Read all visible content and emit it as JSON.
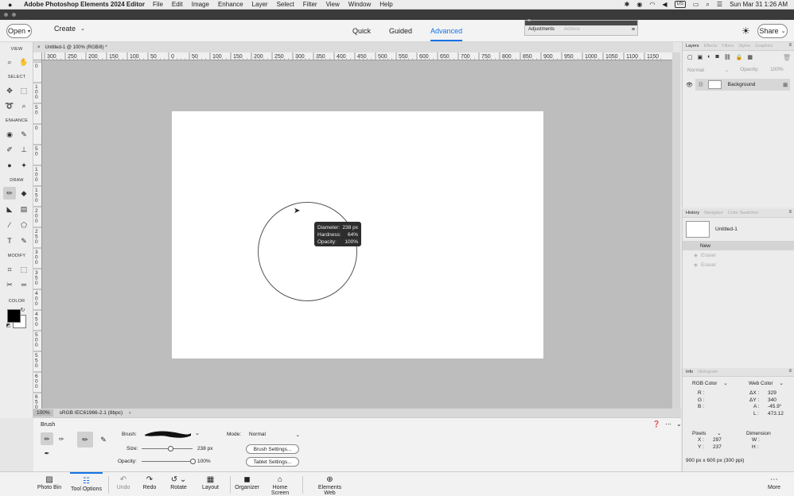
{
  "menubar": {
    "app_name": "Adobe Photoshop Elements 2024 Editor",
    "items": [
      "File",
      "Edit",
      "Image",
      "Enhance",
      "Layer",
      "Select",
      "Filter",
      "View",
      "Window",
      "Help"
    ],
    "keyboard": "US",
    "datetime": "Sun Mar 31  1:26 AM"
  },
  "topbar": {
    "open_label": "Open",
    "create_label": "Create",
    "modes": [
      "Quick",
      "Guided",
      "Advanced"
    ],
    "active_mode": "Advanced",
    "share_label": "Share"
  },
  "floating_panel": {
    "tabs": [
      "Adjustments",
      "Actions"
    ]
  },
  "document": {
    "tab_title": "Untitled-1 @ 100% (RGB/8) *",
    "zoom": "100%",
    "profile": "sRGB IEC61966-2.1 (8bpc)"
  },
  "rulers": {
    "h_labels": [
      "300",
      "250",
      "200",
      "150",
      "100",
      "50",
      "0",
      "50",
      "100",
      "150",
      "200",
      "250",
      "300",
      "350",
      "400",
      "450",
      "500",
      "550",
      "600",
      "650",
      "700",
      "750",
      "800",
      "850",
      "900",
      "950",
      "1000",
      "1050",
      "1100",
      "1150"
    ],
    "v_labels": [
      "0",
      "1\n0\n0",
      "5\n0",
      "0",
      "5\n0",
      "1\n0\n0",
      "1\n5\n0",
      "2\n0\n0",
      "2\n5\n0",
      "3\n0\n0",
      "3\n5\n0",
      "4\n0\n0",
      "4\n5\n0",
      "5\n0\n0",
      "5\n5\n0",
      "6\n0\n0",
      "6\n5\n0",
      "7"
    ]
  },
  "toolbar": {
    "sections": [
      "VIEW",
      "SELECT",
      "ENHANCE",
      "DRAW",
      "MODIFY",
      "COLOR"
    ]
  },
  "brush_tooltip": {
    "diameter_label": "Diameter:",
    "diameter_value": "238 px",
    "hardness_label": "Hardness:",
    "hardness_value": "64%",
    "opacity_label": "Opacity:",
    "opacity_value": "100%"
  },
  "layers_panel": {
    "tabs": [
      "Layers",
      "Effects",
      "Filters",
      "Styles",
      "Graphics"
    ],
    "blend_mode": "Normal",
    "opacity_label": "Opacity:",
    "opacity_value": "100%",
    "layer_name": "Background"
  },
  "history_panel": {
    "tabs": [
      "History",
      "Navigator",
      "Color Swatches"
    ],
    "snapshot": "Untitled-1",
    "states": [
      {
        "label": "New",
        "active": true
      },
      {
        "label": "Eraser",
        "active": false
      },
      {
        "label": "Eraser",
        "active": false
      }
    ]
  },
  "info_panel": {
    "tabs": [
      "Info",
      "Histogram"
    ],
    "left_mode": "RGB Color",
    "right_mode": "Web Color",
    "r_label": "R :",
    "g_label": "G :",
    "b_label": "B :",
    "dx_label": "ΔX :",
    "dx_value": "329",
    "dy_label": "ΔY :",
    "dy_value": "340",
    "a_label": "A :",
    "a_value": "-45.9°",
    "l_label": "L :",
    "l_value": "473.12",
    "units": "Pixels",
    "dimension_label": "Dimension",
    "x_label": "X :",
    "x_value": "297",
    "y_label": "Y :",
    "y_value": "237",
    "w_label": "W :",
    "h_label": "H :",
    "doc_size": "900 px x 600 px (300 ppi)"
  },
  "tool_options": {
    "tool_name": "Brush",
    "brush_label": "Brush:",
    "mode_label": "Mode:",
    "mode_value": "Normal",
    "size_label": "Size:",
    "size_value": "238 px",
    "size_percent": 0.57,
    "opacity_label": "Opacity:",
    "opacity_value": "100%",
    "opacity_percent": 1.0,
    "brush_settings": "Brush Settings...",
    "tablet_settings": "Tablet Settings..."
  },
  "bottom_bar": {
    "photo_bin": "Photo Bin",
    "tool_options": "Tool Options",
    "undo": "Undo",
    "redo": "Redo",
    "rotate": "Rotate",
    "layout": "Layout",
    "organizer": "Organizer",
    "home_screen": "Home Screen",
    "elements_web": "Elements Web",
    "more": "More"
  }
}
